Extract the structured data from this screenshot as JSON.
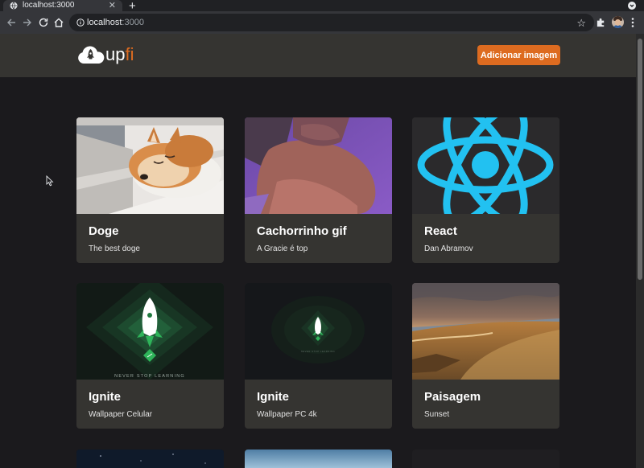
{
  "browser": {
    "tab_title": "localhost:3000",
    "url_host": "localhost",
    "url_port": ":3000"
  },
  "header": {
    "logo_text_a": "up",
    "logo_text_b": "fi",
    "add_button": "Adicionar imagem"
  },
  "cards": [
    {
      "title": "Doge",
      "description": "The best doge"
    },
    {
      "title": "Cachorrinho gif",
      "description": "A Gracie é top"
    },
    {
      "title": "React",
      "description": "Dan Abramov"
    },
    {
      "title": "Ignite",
      "description": "Wallpaper Celular",
      "image_text": "NEVER STOP LEARNING"
    },
    {
      "title": "Ignite",
      "description": "Wallpaper PC 4k",
      "image_text": "NEVER STOP LEARNING"
    },
    {
      "title": "Paisagem",
      "description": "Sunset"
    }
  ],
  "colors": {
    "accent": "#dd6b20",
    "background": "#1b1a1d",
    "card": "#353431",
    "react": "#22c1f1"
  }
}
